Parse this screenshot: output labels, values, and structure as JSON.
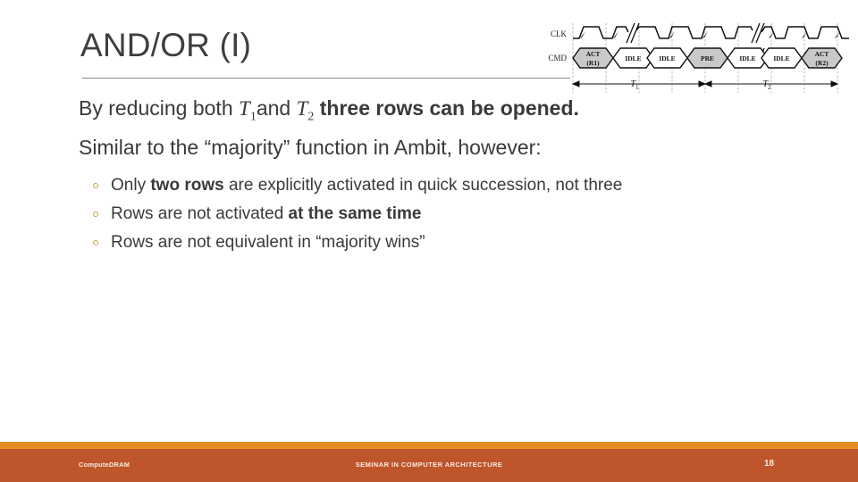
{
  "slide": {
    "title": "AND/OR (I)",
    "lead_lines": [
      {
        "segments": [
          {
            "text": "By reducing both ",
            "style": "regular"
          },
          {
            "text": "T",
            "sub": "1",
            "style": "math"
          },
          {
            "text": "and ",
            "style": "regular"
          },
          {
            "text": "T",
            "sub": "2",
            "style": "math"
          },
          {
            "text": " three rows can be opened.",
            "style": "bold"
          }
        ]
      },
      {
        "segments": [
          {
            "text": "Similar to the “majority” function in Ambit, however:",
            "style": "regular"
          }
        ]
      }
    ],
    "bullets": [
      {
        "segments": [
          {
            "text": "Only ",
            "style": "regular"
          },
          {
            "text": "two rows",
            "style": "bold"
          },
          {
            "text": " are explicitly activated in quick succession, not three",
            "style": "regular"
          }
        ]
      },
      {
        "segments": [
          {
            "text": "Rows are not activated ",
            "style": "regular"
          },
          {
            "text": "at the same time",
            "style": "bold"
          }
        ]
      },
      {
        "segments": [
          {
            "text": "Rows are not equivalent in “majority wins”",
            "style": "regular"
          }
        ]
      }
    ]
  },
  "timing_diagram": {
    "signal_labels": [
      "CLK",
      "CMD"
    ],
    "commands": [
      {
        "label_top": "ACT",
        "label_bottom": "(R1)",
        "shaded": true
      },
      {
        "label_top": "IDLE",
        "label_bottom": "",
        "shaded": false
      },
      {
        "label_top": "IDLE",
        "label_bottom": "",
        "shaded": false
      },
      {
        "label_top": "PRE",
        "label_bottom": "",
        "shaded": true
      },
      {
        "label_top": "IDLE",
        "label_bottom": "",
        "shaded": false
      },
      {
        "label_top": "IDLE",
        "label_bottom": "",
        "shaded": false
      },
      {
        "label_top": "ACT",
        "label_bottom": "(R2)",
        "shaded": true
      }
    ],
    "intervals": [
      {
        "label": "T",
        "sub": "1"
      },
      {
        "label": "T",
        "sub": "2"
      }
    ]
  },
  "footer": {
    "left_label": "ComputeDRAM",
    "center_label": "SEMINAR IN COMPUTER ARCHITECTURE",
    "page_number": "18"
  },
  "colors": {
    "accent_stripe": "#e38c21",
    "footer_band": "#bf552a",
    "title_text": "#3f3f3f",
    "body_text": "#3a3a3a",
    "bullet_marker": "#c8a03a"
  }
}
